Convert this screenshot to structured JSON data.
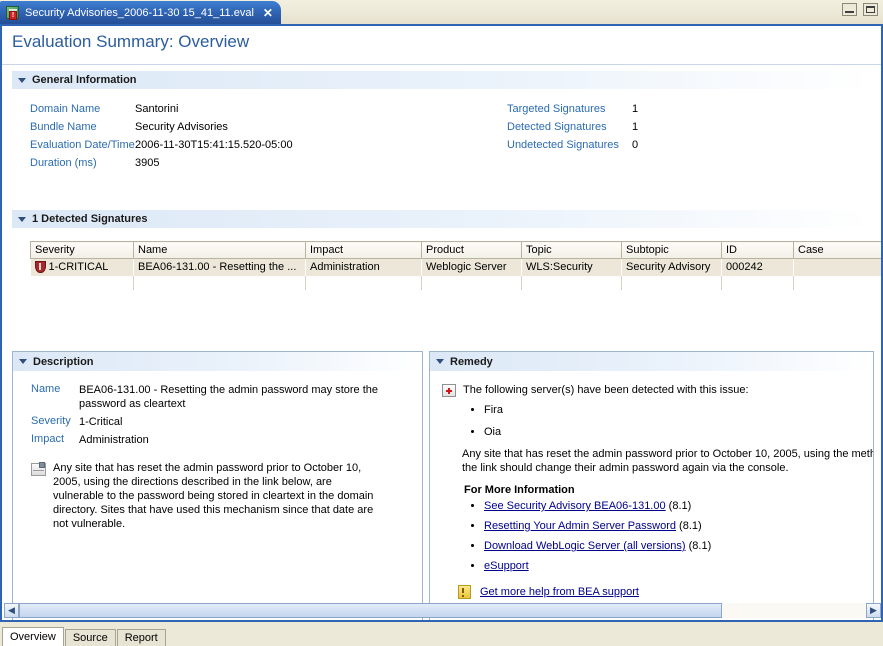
{
  "window": {
    "tab_title": "Security Advisories_2006-11-30 15_41_11.eval",
    "tab_icon": "eval-document-icon",
    "close_glyph": "✕",
    "minimize_label": "Minimize",
    "maximize_label": "Maximize"
  },
  "page": {
    "title": "Evaluation Summary: Overview"
  },
  "general": {
    "section_title": "General Information",
    "left_rows": [
      {
        "label": "Domain Name",
        "value": "Santorini"
      },
      {
        "label": "Bundle Name",
        "value": "Security Advisories"
      },
      {
        "label": "Evaluation Date/Time",
        "value": "2006-11-30T15:41:15.520-05:00"
      },
      {
        "label": "Duration (ms)",
        "value": "3905"
      }
    ],
    "right_rows": [
      {
        "label": "Targeted Signatures",
        "value": "1"
      },
      {
        "label": "Detected Signatures",
        "value": "1"
      },
      {
        "label": "Undetected Signatures",
        "value": "0"
      }
    ]
  },
  "detected": {
    "section_title": "1 Detected Signatures",
    "columns": [
      "Severity",
      "Name",
      "Impact",
      "Product",
      "Topic",
      "Subtopic",
      "ID",
      "Case"
    ],
    "rows": [
      {
        "severity": "1-CRITICAL",
        "severity_icon": "critical-shield-icon",
        "name": "BEA06-131.00 - Resetting the ...",
        "impact": "Administration",
        "product": "Weblogic Server",
        "topic": "WLS:Security",
        "subtopic": "Security Advisory",
        "id": "000242",
        "case": ""
      }
    ]
  },
  "description": {
    "section_title": "Description",
    "rows": [
      {
        "label": "Name",
        "value": "BEA06-131.00 - Resetting the admin password may store the password as cleartext"
      },
      {
        "label": "Severity",
        "value": "1-Critical"
      },
      {
        "label": "Impact",
        "value": "Administration"
      }
    ],
    "note_icon": "note-icon",
    "note": "Any site that has reset the admin password prior to October 10, 2005, using the directions described in the link below, are vulnerable to the password being stored in cleartext in the domain directory. Sites that have used this mechanism since that date are not vulnerable."
  },
  "remedy": {
    "section_title": "Remedy",
    "kit_icon": "first-aid-kit-icon",
    "lead": "The following server(s) have been detected with this issue:",
    "servers": [
      "Fira",
      "Oia"
    ],
    "paragraph_line1": " Any site that has reset the admin password prior to October 10, 2005, using the meth",
    "paragraph_line2": "the link should change their admin password again via the console.",
    "more_info_heading": "For More Information",
    "links": [
      {
        "text": "See Security Advisory BEA06-131.00",
        "suffix": " (8.1)"
      },
      {
        "text": "Resetting Your Admin Server Password",
        "suffix": " (8.1)"
      },
      {
        "text": "Download WebLogic Server (all versions)",
        "suffix": " (8.1)"
      },
      {
        "text": "eSupport",
        "suffix": ""
      }
    ],
    "help_icon": "help-book-icon",
    "help_link": "Get more help from BEA support"
  },
  "scrollbar": {
    "left_arrow": "◀",
    "right_arrow": "▶"
  },
  "page_tabs": [
    {
      "label": "Overview",
      "active": true
    },
    {
      "label": "Source",
      "active": false
    },
    {
      "label": "Report",
      "active": false
    }
  ]
}
